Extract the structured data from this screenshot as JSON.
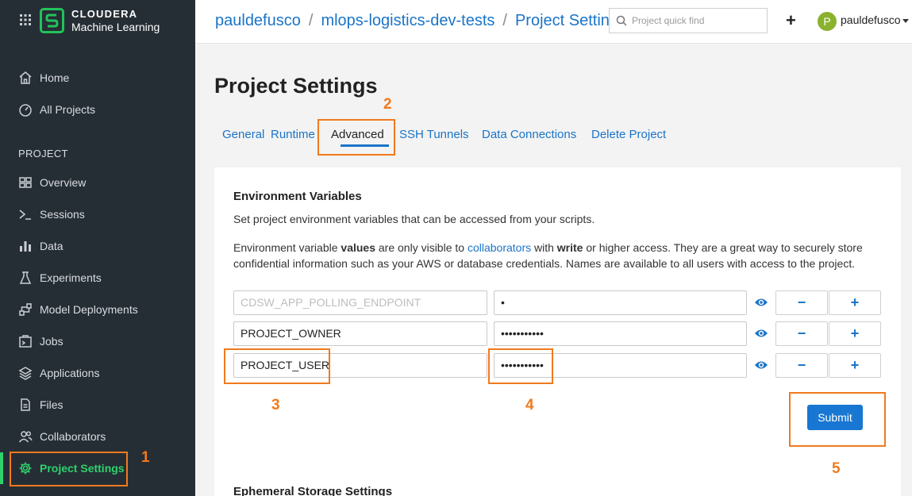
{
  "sidebar": {
    "brand_line1": "CLOUDERA",
    "brand_line2": "Machine Learning",
    "items_top": [
      {
        "label": "Home",
        "icon": "home-icon"
      },
      {
        "label": "All Projects",
        "icon": "gauge-icon"
      }
    ],
    "section_label": "PROJECT",
    "items": [
      {
        "label": "Overview",
        "icon": "overview-icon"
      },
      {
        "label": "Sessions",
        "icon": "terminal-icon"
      },
      {
        "label": "Data",
        "icon": "bar-chart-icon"
      },
      {
        "label": "Experiments",
        "icon": "flask-icon"
      },
      {
        "label": "Model Deployments",
        "icon": "network-icon"
      },
      {
        "label": "Jobs",
        "icon": "jobs-icon"
      },
      {
        "label": "Applications",
        "icon": "layers-icon"
      },
      {
        "label": "Files",
        "icon": "file-icon"
      },
      {
        "label": "Collaborators",
        "icon": "users-icon"
      },
      {
        "label": "Project Settings",
        "icon": "gear-icon",
        "active": true
      }
    ]
  },
  "header": {
    "breadcrumb": [
      "pauldefusco",
      "mlops-logistics-dev-tests",
      "Project Settings"
    ],
    "quickfind_placeholder": "Project quick find",
    "add_label": "+",
    "avatar_letter": "P",
    "user_name": "pauldefusco"
  },
  "page": {
    "title": "Project Settings",
    "tabs": [
      "General",
      "Runtime",
      "Advanced",
      "SSH Tunnels",
      "Data Connections",
      "Delete Project"
    ],
    "active_tab": "Advanced"
  },
  "env_section": {
    "title": "Environment Variables",
    "description": "Set project environment variables that can be accessed from your scripts.",
    "para_1": "Environment variable ",
    "para_bold_1": "values",
    "para_2": " are only visible to ",
    "para_link": "collaborators",
    "para_3": " with ",
    "para_bold_2": "write",
    "para_4": " or higher access. They are a great way to securely store confidential information such as your AWS or database credentials. Names are available to all users with access to the project.",
    "rows": [
      {
        "name": "CDSW_APP_POLLING_ENDPOINT",
        "value": "•",
        "disabled": true
      },
      {
        "name": "PROJECT_OWNER",
        "value": "•••••••••••"
      },
      {
        "name": "PROJECT_USER",
        "value": "•••••••••••"
      }
    ],
    "minus_label": "−",
    "plus_label": "+",
    "submit_label": "Submit"
  },
  "next_section_title": "Ephemeral Storage Settings",
  "annotations": [
    "1",
    "2",
    "3",
    "4",
    "5"
  ],
  "colors": {
    "sidebar_bg": "#262e35",
    "accent_green": "#2ed26c",
    "link_blue": "#1a74c8",
    "annotation_orange": "#f07a1e",
    "submit_blue": "#1877d2"
  }
}
